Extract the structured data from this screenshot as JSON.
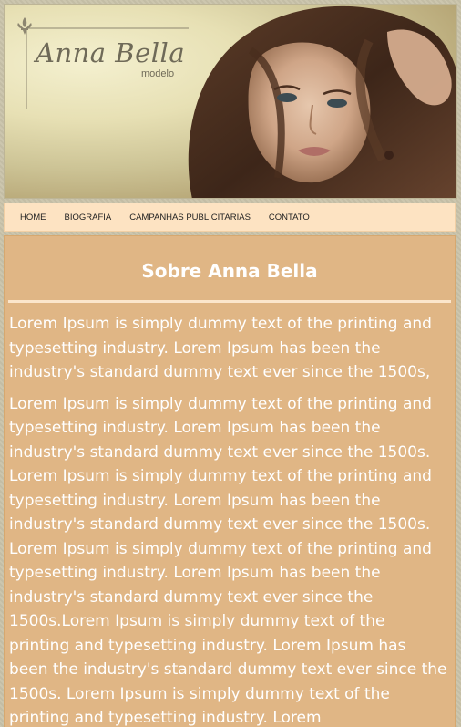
{
  "header": {
    "logo_title": "Anna Bella",
    "logo_subtitle": "modelo",
    "icon": "fleur-de-lis-icon"
  },
  "nav": {
    "items": [
      {
        "label": "HOME"
      },
      {
        "label": "BIOGRAFIA"
      },
      {
        "label": "CAMPANHAS PUBLICITARIAS"
      },
      {
        "label": "CONTATO"
      }
    ]
  },
  "main": {
    "title": "Sobre Anna Bella",
    "paragraphs": [
      "Lorem Ipsum is simply dummy text of the printing and typesetting industry. Lorem Ipsum has been the industry's standard dummy text ever since the 1500s,",
      "Lorem Ipsum is simply dummy text of the printing and typesetting industry. Lorem Ipsum has been the industry's standard dummy text ever since the 1500s. Lorem Ipsum is simply dummy text of the printing and typesetting industry. Lorem Ipsum has been the industry's standard dummy text ever since the 1500s. Lorem Ipsum is simply dummy text of the printing and typesetting industry. Lorem Ipsum has been the industry's standard dummy text ever since the 1500s.Lorem Ipsum is simply dummy text of the printing and typesetting industry. Lorem Ipsum has been the industry's standard dummy text ever since the 1500s. Lorem Ipsum is simply dummy text of the printing and typesetting industry. Lorem"
    ]
  },
  "colors": {
    "nav_background": "#fde3c2",
    "content_background": "#e0b685",
    "text_color": "#ffffff"
  }
}
